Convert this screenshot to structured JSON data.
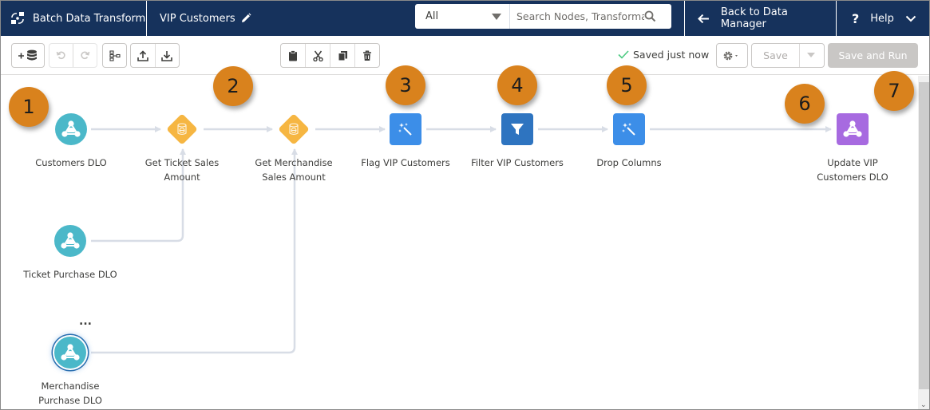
{
  "header": {
    "app_name": "Batch Data Transform",
    "app_icon": "transform-icon",
    "doc_title": "VIP Customers",
    "edit_icon": "pencil-icon",
    "search_scope": "All",
    "search_placeholder": "Search Nodes, Transformat",
    "back_label": "Back to Data Manager",
    "help_label": "Help"
  },
  "toolbar": {
    "add_input_icon": "add-data-icon",
    "undo_icon": "undo-icon",
    "redo_icon": "redo-icon",
    "hierarchy_icon": "hierarchy-icon",
    "upload_icon": "upload-icon",
    "download_icon": "download-icon",
    "paste_icon": "clipboard-icon",
    "cut_icon": "scissors-icon",
    "copy_icon": "copy-icon",
    "delete_icon": "trash-icon",
    "status_text": "Saved just now",
    "settings_icon": "gear-icon",
    "save_label": "Save",
    "save_run_label": "Save and Run"
  },
  "colors": {
    "header_bg": "#16325c",
    "source_node": "#4bb8c9",
    "join_node": "#f6b642",
    "transform_node": "#3c8ee8",
    "filter_node": "#2e74c0",
    "output_node": "#a76ae0",
    "callout": "#d9821d",
    "edge": "#d8dde6"
  },
  "nodes": [
    {
      "id": "customers",
      "label": "Customers DLO",
      "type": "input"
    },
    {
      "id": "get_ticket",
      "label": "Get Ticket Sales Amount",
      "type": "join"
    },
    {
      "id": "get_merch",
      "label": "Get Merchandise Sales Amount",
      "type": "join"
    },
    {
      "id": "flag_vip",
      "label": "Flag VIP Customers",
      "type": "transform"
    },
    {
      "id": "filter_vip",
      "label": "Filter VIP Customers",
      "type": "filter"
    },
    {
      "id": "drop_cols",
      "label": "Drop Columns",
      "type": "transform"
    },
    {
      "id": "update_vip",
      "label": "Update VIP Customers DLO",
      "type": "output"
    },
    {
      "id": "ticket_purchase",
      "label": "Ticket Purchase DLO",
      "type": "input"
    },
    {
      "id": "merch_purchase",
      "label": "Merchandise Purchase DLO",
      "type": "input",
      "selected": true
    }
  ],
  "node_menu_label": "...",
  "callouts": [
    "1",
    "2",
    "3",
    "4",
    "5",
    "6",
    "7"
  ]
}
